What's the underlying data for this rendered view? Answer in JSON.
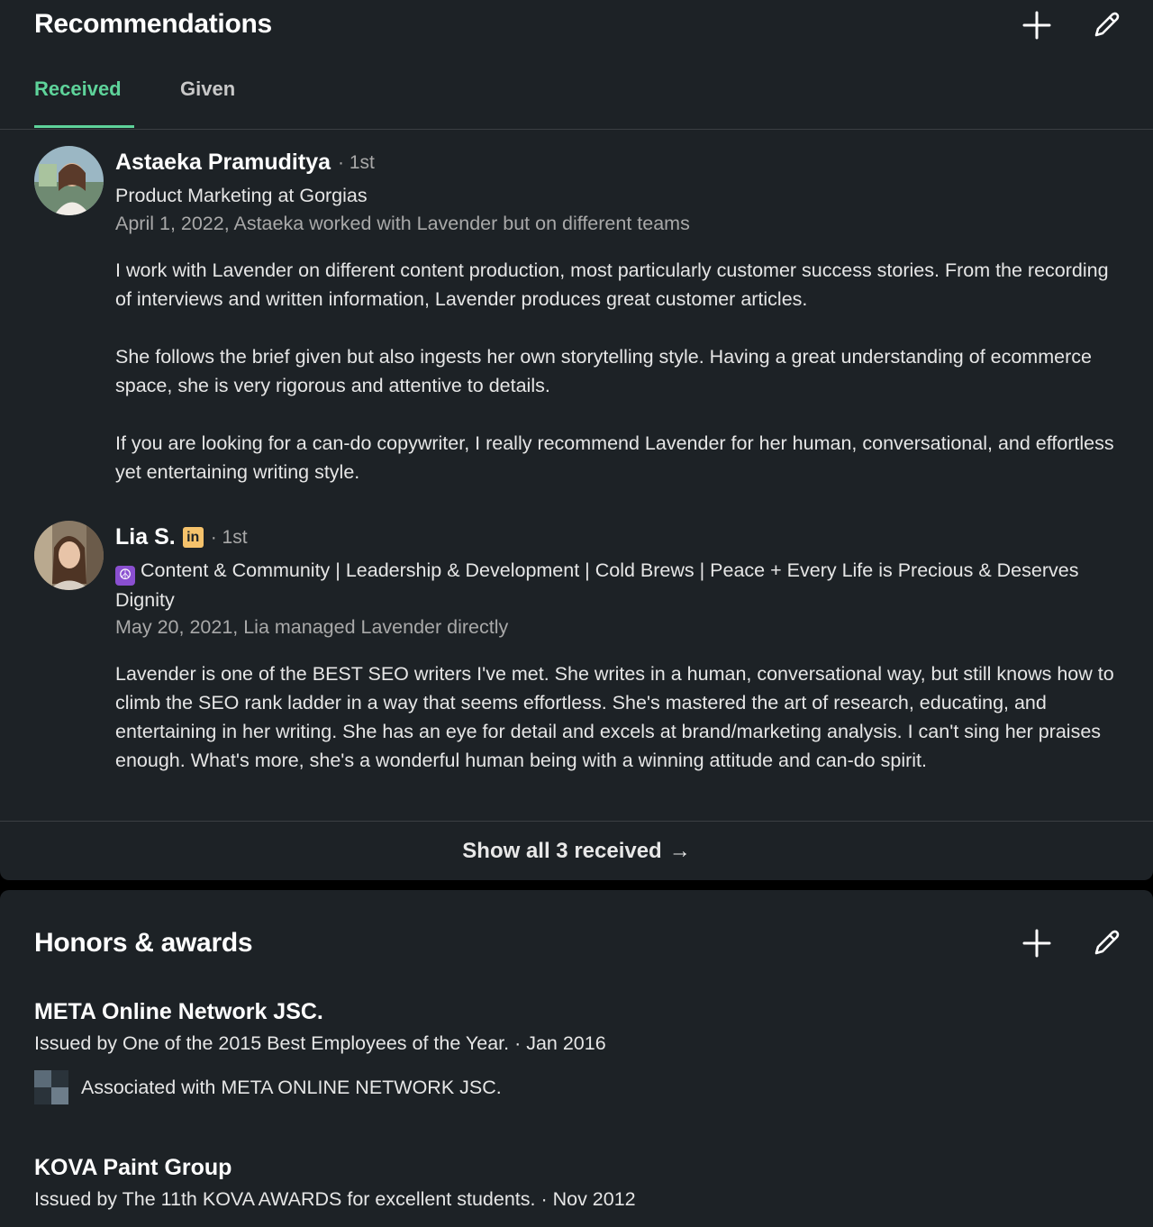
{
  "recommendations": {
    "title": "Recommendations",
    "tabs": [
      {
        "label": "Received",
        "active": true
      },
      {
        "label": "Given",
        "active": false
      }
    ],
    "items": [
      {
        "name": "Astaeka Pramuditya",
        "degree": "· 1st",
        "headline": "Product Marketing at Gorgias",
        "meta": "April 1, 2022, Astaeka worked with Lavender but on different teams",
        "paragraphs": [
          "I work with Lavender on different content production, most particularly customer success stories. From the recording of interviews and written information, Lavender produces great customer articles.",
          "She follows the brief given but also ingests her own storytelling style. Having a great understanding of ecommerce space, she is very rigorous and attentive to details.",
          "If you are looking for a can-do copywriter, I really recommend Lavender for her human, conversational, and effortless yet entertaining writing style."
        ]
      },
      {
        "name": "Lia S.",
        "badge": "in",
        "degree": "· 1st",
        "headline_emoji": "☮",
        "headline": "Content & Community | Leadership & Development | Cold Brews | Peace + Every Life is Precious & Deserves Dignity",
        "meta": "May 20, 2021, Lia managed Lavender directly",
        "paragraphs": [
          "Lavender is one of the BEST SEO writers I've met. She writes in a human, conversational way, but still knows how to climb the SEO rank ladder in a way that seems effortless. She's mastered the art of research, educating, and entertaining in her writing. She has an eye for detail and excels at brand/marketing analysis. I can't sing her praises enough. What's more, she's a wonderful human being with a winning attitude and can-do spirit."
        ]
      }
    ],
    "show_all": {
      "label": "Show all 3 received",
      "arrow": "→"
    }
  },
  "honors": {
    "title": "Honors & awards",
    "items": [
      {
        "title": "META Online Network JSC.",
        "issuer": "Issued by One of the 2015 Best Employees of the Year. · Jan 2016",
        "associated": "Associated with META ONLINE NETWORK JSC."
      },
      {
        "title": "KOVA Paint Group",
        "issuer": "Issued by The 11th KOVA AWARDS for excellent students. · Nov 2012"
      }
    ]
  },
  "colors": {
    "accent": "#5ed39a",
    "card_bg": "#1d2226",
    "page_bg": "#000000",
    "muted_text": "#a9a9a9",
    "linkedin_badge": "#f5c26b",
    "peace_badge": "#8a4fd0"
  },
  "icons": {
    "add": "plus-icon",
    "edit": "pencil-icon",
    "arrow": "arrow-right-icon"
  }
}
